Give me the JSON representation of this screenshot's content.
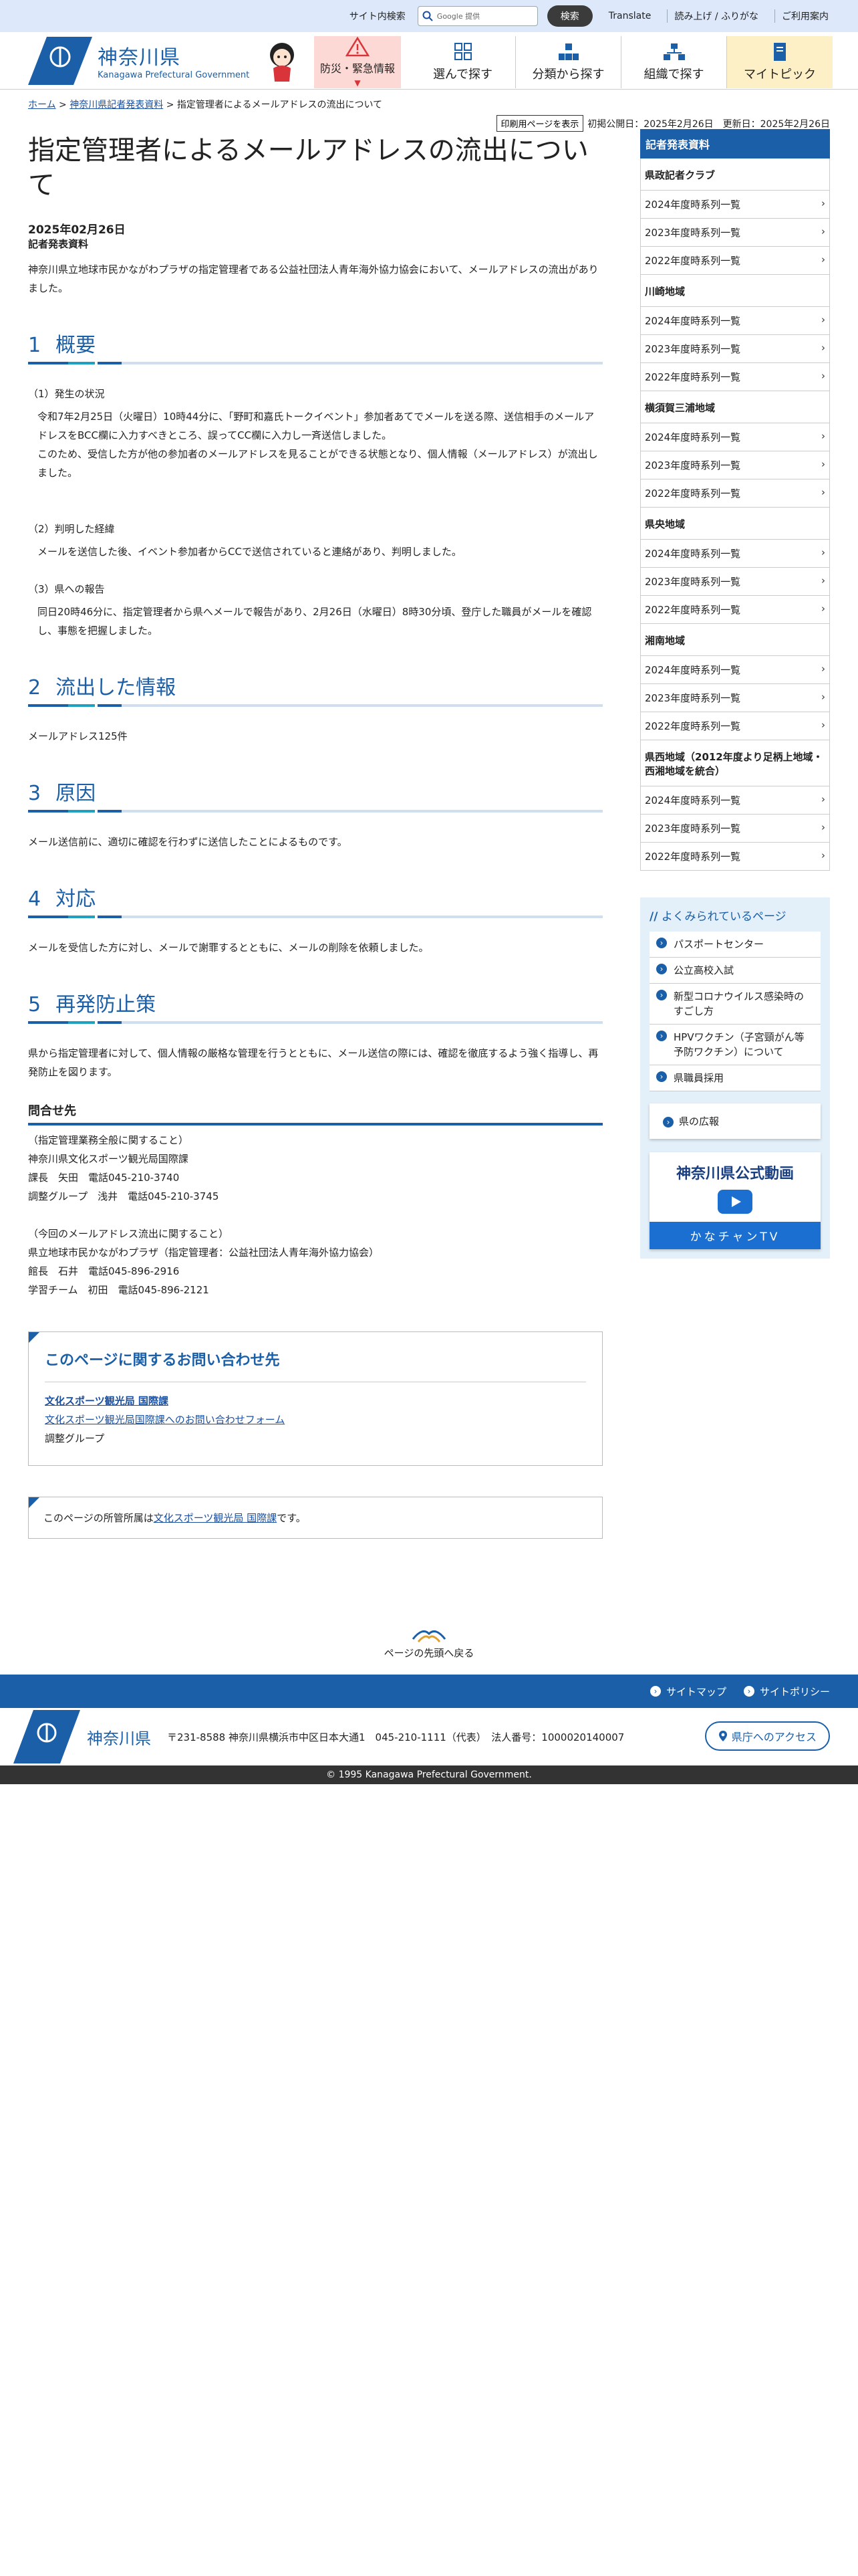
{
  "utility": {
    "search_label": "サイト内検索",
    "search_placeholder": "Google 提供",
    "search_button": "検索",
    "links": [
      "Translate",
      "読み上げ / ふりがな",
      "ご利用案内"
    ]
  },
  "header": {
    "logo_jp": "神奈川県",
    "logo_en": "Kanagawa Prefectural Government",
    "nav": [
      "防災・緊急情報",
      "選んで探す",
      "分類から探す",
      "組織で探す",
      "マイトピック"
    ]
  },
  "breadcrumb": {
    "home": "ホーム",
    "sep": ">",
    "parent": "神奈川県記者発表資料",
    "current": "指定管理者によるメールアドレスの流出について"
  },
  "meta": {
    "print_button": "印刷用ページを表示",
    "dates": "初掲公開日：2025年2月26日　更新日：2025年2月26日"
  },
  "article": {
    "title": "指定管理者によるメールアドレスの流出について",
    "date": "2025年02月26日",
    "category": "記者発表資料",
    "intro": "神奈川県立地球市民かながわプラザの指定管理者である公益社団法人青年海外協力協会において、メールアドレスの流出がありました。",
    "sections": [
      {
        "num": "1",
        "title": "概要",
        "subs": [
          {
            "heading": "（1）発生の状況",
            "texts": [
              "令和7年2月25日（火曜日）10時44分に、「野町和嘉氏トークイベント」参加者あてでメールを送る際、送信相手のメールアドレスをBCC欄に入力すべきところ、誤ってCC欄に入力し一斉送信しました。",
              "このため、受信した方が他の参加者のメールアドレスを見ることができる状態となり、個人情報（メールアドレス）が流出しました。"
            ]
          },
          {
            "heading": "（2）判明した経緯",
            "texts": [
              "メールを送信した後、イベント参加者からCCで送信されていると連絡があり、判明しました。"
            ]
          },
          {
            "heading": "（3）県への報告",
            "texts": [
              "同日20時46分に、指定管理者から県へメールで報告があり、2月26日（水曜日）8時30分頃、登庁した職員がメールを確認し、事態を把握しました。"
            ]
          }
        ]
      },
      {
        "num": "2",
        "title": "流出した情報",
        "text": "メールアドレス125件"
      },
      {
        "num": "3",
        "title": "原因",
        "text": "メール送信前に、適切に確認を行わずに送信したことによるものです。"
      },
      {
        "num": "4",
        "title": "対応",
        "text": "メールを受信した方に対し、メールで謝罪するとともに、メールの削除を依頼しました。"
      },
      {
        "num": "5",
        "title": "再発防止策",
        "text": "県から指定管理者に対して、個人情報の厳格な管理を行うとともに、メール送信の際には、確認を徹底するよう強く指導し、再発防止を図ります。"
      }
    ],
    "contact_title": "問合せ先",
    "contact1": [
      "（指定管理業務全般に関すること）",
      "神奈川県文化スポーツ観光局国際課",
      "課長　矢田　電話045-210-3740",
      "調整グループ　浅井　電話045-210-3745"
    ],
    "contact2": [
      "（今回のメールアドレス流出に関すること）",
      "県立地球市民かながわプラザ（指定管理者：公益社団法人青年海外協力協会）",
      "館長　石井　電話045-896-2916",
      "学習チーム　初田　電話045-896-2121"
    ]
  },
  "inquiry": {
    "title": "このページに関するお問い合わせ先",
    "org_link": "文化スポーツ観光局 国際課",
    "form_link": "文化スポーツ観光局国際課へのお問い合わせフォーム",
    "group": "調整グループ"
  },
  "owner": {
    "prefix": "このページの所管所属は",
    "link": "文化スポーツ観光局 国際課",
    "suffix": "です。"
  },
  "sidebar": {
    "head": "記者発表資料",
    "groups": [
      {
        "name": "県政記者クラブ",
        "items": [
          "2024年度時系列一覧",
          "2023年度時系列一覧",
          "2022年度時系列一覧"
        ]
      },
      {
        "name": "川崎地域",
        "items": [
          "2024年度時系列一覧",
          "2023年度時系列一覧",
          "2022年度時系列一覧"
        ]
      },
      {
        "name": "横須賀三浦地域",
        "items": [
          "2024年度時系列一覧",
          "2023年度時系列一覧",
          "2022年度時系列一覧"
        ]
      },
      {
        "name": "県央地域",
        "items": [
          "2024年度時系列一覧",
          "2023年度時系列一覧",
          "2022年度時系列一覧"
        ]
      },
      {
        "name": "湘南地域",
        "items": [
          "2024年度時系列一覧",
          "2023年度時系列一覧",
          "2022年度時系列一覧"
        ]
      },
      {
        "name": "県西地域（2012年度より足柄上地域・西湘地域を統合）",
        "items": [
          "2024年度時系列一覧",
          "2023年度時系列一覧",
          "2022年度時系列一覧"
        ]
      }
    ],
    "popular_title": "よくみられているページ",
    "popular": [
      "パスポートセンター",
      "公立高校入試",
      "新型コロナウイルス感染時のすごし方",
      "HPVワクチン（子宮頸がん等予防ワクチン）について",
      "県職員採用"
    ],
    "koho": "県の広報",
    "video_title": "神奈川県公式動画",
    "video_bar": "かなチャンTV"
  },
  "pagetop": "ページの先頭へ戻る",
  "footer": {
    "links": [
      "サイトマップ",
      "サイトポリシー"
    ],
    "logo": "神奈川県",
    "address": "〒231-8588 神奈川県横浜市中区日本大通1　045-210-1111（代表）　法人番号：1000020140007",
    "access": "県庁へのアクセス",
    "copyright": "© 1995 Kanagawa Prefectural Government."
  }
}
